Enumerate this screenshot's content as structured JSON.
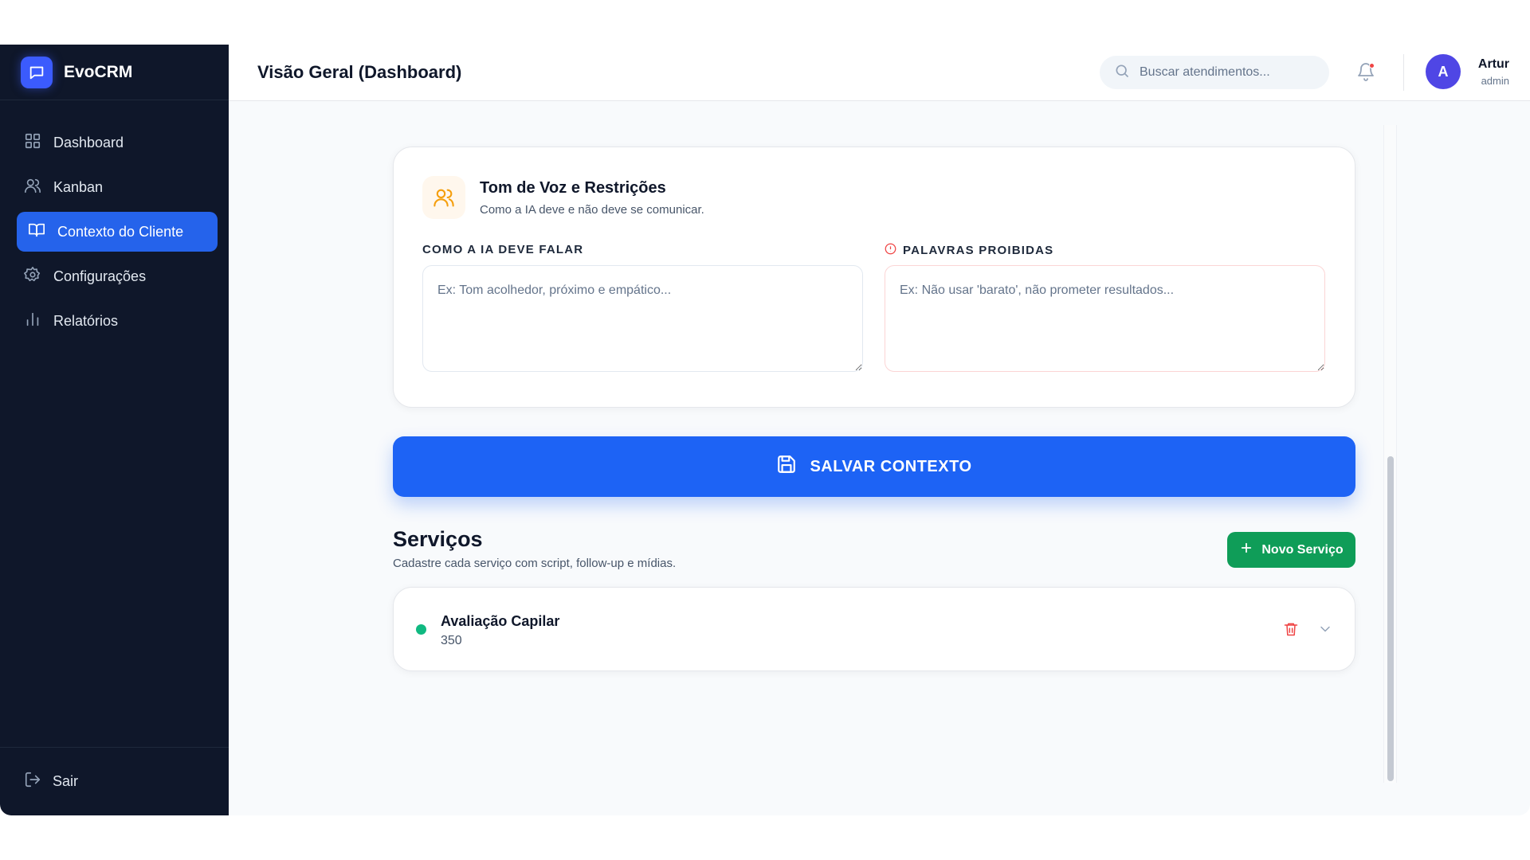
{
  "app": {
    "name": "EvoCRM",
    "logo_icon": "chat-icon"
  },
  "sidebar": {
    "items": [
      {
        "label": "Dashboard",
        "icon": "grid-icon",
        "active": false
      },
      {
        "label": "Kanban",
        "icon": "users-icon",
        "active": false
      },
      {
        "label": "Contexto do Cliente",
        "icon": "book-icon",
        "active": true
      },
      {
        "label": "Configurações",
        "icon": "gear-icon",
        "active": false
      },
      {
        "label": "Relatórios",
        "icon": "bar-chart-icon",
        "active": false
      }
    ],
    "logout_label": "Sair"
  },
  "header": {
    "title": "Visão Geral (Dashboard)",
    "search_placeholder": "Buscar atendimentos...",
    "user": {
      "initial": "A",
      "name": "Artur",
      "role": "admin"
    }
  },
  "tone_section": {
    "title": "Tom de Voz e Restrições",
    "subtitle": "Como a IA deve e não deve se comunicar.",
    "speak_label": "COMO A IA DEVE FALAR",
    "speak_placeholder": "Ex: Tom acolhedor, próximo e empático...",
    "forbidden_label": "PALAVRAS PROIBIDAS",
    "forbidden_placeholder": "Ex: Não usar 'barato', não prometer resultados..."
  },
  "save_button_label": "SALVAR CONTEXTO",
  "services": {
    "title": "Serviços",
    "subtitle": "Cadastre cada serviço com script, follow-up e mídias.",
    "new_button_label": "Novo Serviço",
    "items": [
      {
        "name": "Avaliação Capilar",
        "price": "350",
        "status_color": "#10b981"
      }
    ]
  },
  "colors": {
    "primary": "#1d63f5",
    "sidebar_bg": "#0f172a",
    "success": "#0f9d58",
    "danger": "#ef4444"
  }
}
